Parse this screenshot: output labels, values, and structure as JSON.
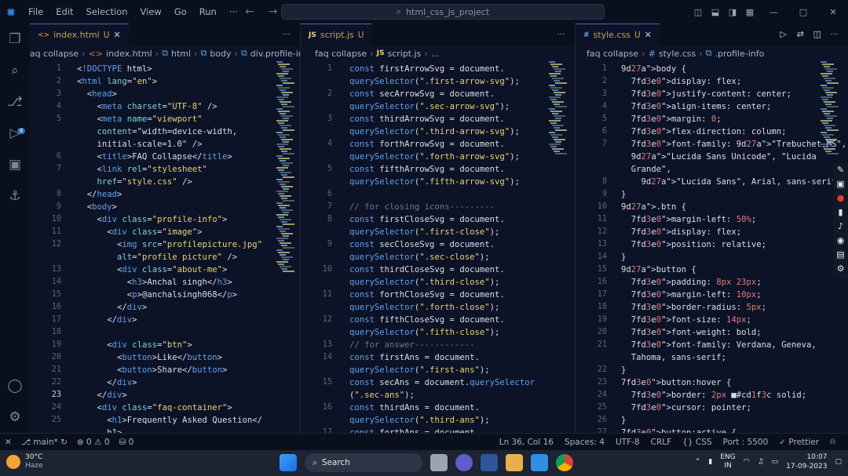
{
  "titlebar": {
    "menu": [
      "File",
      "Edit",
      "Selection",
      "View",
      "Go",
      "Run",
      "···"
    ],
    "search": "html_css_js_project"
  },
  "editors": [
    {
      "tab": {
        "name": "index.html",
        "status": "U"
      },
      "crumbs": [
        "faq collapse",
        "index.html",
        "html",
        "body",
        "div.profile-info"
      ],
      "lines": [
        {
          "n": "1",
          "t": "<!DOCTYPE html>"
        },
        {
          "n": "2",
          "t": "<html lang=\"en\">"
        },
        {
          "n": "3",
          "t": "  <head>"
        },
        {
          "n": "4",
          "t": "    <meta charset=\"UTF-8\" />"
        },
        {
          "n": "5",
          "t": "    <meta name=\"viewport\""
        },
        {
          "n": "",
          "t": "    content=\"width=device-width,"
        },
        {
          "n": "",
          "t": "    initial-scale=1.0\" />"
        },
        {
          "n": "6",
          "t": "    <title>FAQ Collapse</title>"
        },
        {
          "n": "7",
          "t": "    <link rel=\"stylesheet\""
        },
        {
          "n": "",
          "t": "    href=\"style.css\" />"
        },
        {
          "n": "8",
          "t": "  </head>"
        },
        {
          "n": "9",
          "t": "  <body>"
        },
        {
          "n": "10",
          "t": "    <div class=\"profile-info\">"
        },
        {
          "n": "11",
          "t": "      <div class=\"image\">"
        },
        {
          "n": "12",
          "t": "        <img src=\"profilepicture.jpg\""
        },
        {
          "n": "",
          "t": "        alt=\"profile picture\" />"
        },
        {
          "n": "13",
          "t": "        <div class=\"about-me\">"
        },
        {
          "n": "14",
          "t": "          <h3>Anchal singh</h3>"
        },
        {
          "n": "15",
          "t": "          <p>@anchalsingh068</p>"
        },
        {
          "n": "16",
          "t": "        </div>"
        },
        {
          "n": "17",
          "t": "      </div>"
        },
        {
          "n": "18",
          "t": ""
        },
        {
          "n": "19",
          "t": "      <div class=\"btn\">"
        },
        {
          "n": "20",
          "t": "        <button>Like</button>"
        },
        {
          "n": "21",
          "t": "        <button>Share</button>"
        },
        {
          "n": "22",
          "t": "      </div>"
        },
        {
          "n": "23",
          "t": "    </div>"
        },
        {
          "n": "24",
          "t": "    <div class=\"faq-container\">"
        },
        {
          "n": "25",
          "t": "      <h1>Frequently Asked Question</"
        },
        {
          "n": "",
          "t": "      h1>"
        }
      ]
    },
    {
      "tab": {
        "name": "script.js",
        "status": "U"
      },
      "crumbs": [
        "faq collapse",
        "script.js",
        "..."
      ],
      "lines": [
        {
          "n": "1",
          "t": "const firstArrowSvg = document."
        },
        {
          "n": "",
          "t": "querySelector(\".first-arrow-svg\");"
        },
        {
          "n": "2",
          "t": "const secArrowSvg = document."
        },
        {
          "n": "",
          "t": "querySelector(\".sec-arrow-svg\");"
        },
        {
          "n": "3",
          "t": "const thirdArrowSvg = document."
        },
        {
          "n": "",
          "t": "querySelector(\".third-arrow-svg\");"
        },
        {
          "n": "4",
          "t": "const forthArrowSvg = document."
        },
        {
          "n": "",
          "t": "querySelector(\".forth-arrow-svg\");"
        },
        {
          "n": "5",
          "t": "const fifthArrowSvg = document."
        },
        {
          "n": "",
          "t": "querySelector(\".fifth-arrow-svg\");"
        },
        {
          "n": "6",
          "t": ""
        },
        {
          "n": "7",
          "t": "// for closing icons---------"
        },
        {
          "n": "8",
          "t": "const firstCloseSvg = document."
        },
        {
          "n": "",
          "t": "querySelector(\".first-close\");"
        },
        {
          "n": "9",
          "t": "const secCloseSvg = document."
        },
        {
          "n": "",
          "t": "querySelector(\".sec-close\");"
        },
        {
          "n": "10",
          "t": "const thirdCloseSvg = document."
        },
        {
          "n": "",
          "t": "querySelector(\".third-close\");"
        },
        {
          "n": "11",
          "t": "const forthCloseSvg = document."
        },
        {
          "n": "",
          "t": "querySelector(\".forth-close\");"
        },
        {
          "n": "12",
          "t": "const fifthCloseSvg = document."
        },
        {
          "n": "",
          "t": "querySelector(\".fifth-close\");"
        },
        {
          "n": "13",
          "t": "// for answer------------"
        },
        {
          "n": "14",
          "t": "const firstAns = document."
        },
        {
          "n": "",
          "t": "querySelector(\".first-ans\");"
        },
        {
          "n": "15",
          "t": "const secAns = document.querySelector"
        },
        {
          "n": "",
          "t": "(\".sec-ans\");"
        },
        {
          "n": "16",
          "t": "const thirdAns = document."
        },
        {
          "n": "",
          "t": "querySelector(\".third-ans\");"
        },
        {
          "n": "17",
          "t": "const forthAns = document."
        }
      ]
    },
    {
      "tab": {
        "name": "style.css",
        "status": "U"
      },
      "crumbs": [
        "faq collapse",
        "style.css",
        ".profile-info"
      ],
      "lines": [
        {
          "n": "1",
          "t": "body {"
        },
        {
          "n": "2",
          "t": "  display: flex;"
        },
        {
          "n": "3",
          "t": "  justify-content: center;"
        },
        {
          "n": "4",
          "t": "  align-items: center;"
        },
        {
          "n": "5",
          "t": "  margin: 0;"
        },
        {
          "n": "6",
          "t": "  flex-direction: column;"
        },
        {
          "n": "7",
          "t": "  font-family: \"Trebuchet MS\","
        },
        {
          "n": "",
          "t": "  \"Lucida Sans Unicode\", \"Lucida"
        },
        {
          "n": "",
          "t": "  Grande\","
        },
        {
          "n": "8",
          "t": "    \"Lucida Sans\", Arial, sans-serif;"
        },
        {
          "n": "9",
          "t": "}"
        },
        {
          "n": "10",
          "t": ".btn {"
        },
        {
          "n": "11",
          "t": "  margin-left: 50%;"
        },
        {
          "n": "12",
          "t": "  display: flex;"
        },
        {
          "n": "13",
          "t": "  position: relative;"
        },
        {
          "n": "14",
          "t": "}"
        },
        {
          "n": "15",
          "t": "button {"
        },
        {
          "n": "16",
          "t": "  padding: 8px 23px;"
        },
        {
          "n": "17",
          "t": "  margin-left: 10px;"
        },
        {
          "n": "18",
          "t": "  border-radius: 5px;"
        },
        {
          "n": "19",
          "t": "  font-size: 14px;"
        },
        {
          "n": "20",
          "t": "  font-weight: bold;"
        },
        {
          "n": "21",
          "t": "  font-family: Verdana, Geneva,"
        },
        {
          "n": "",
          "t": "  Tahoma, sans-serif;"
        },
        {
          "n": "22",
          "t": "}"
        },
        {
          "n": "23",
          "t": "button:hover {"
        },
        {
          "n": "24",
          "t": "  border: 2px ■#cd1f3c solid;"
        },
        {
          "n": "25",
          "t": "  cursor: pointer;"
        },
        {
          "n": "26",
          "t": "}"
        },
        {
          "n": "27",
          "t": "button:active {"
        }
      ]
    }
  ],
  "statusbar": {
    "branch": "main*",
    "problems": "⊗ 0 ⚠ 0",
    "ports": "⛁ 0",
    "position": "Ln 36, Col 16",
    "spaces": "Spaces: 4",
    "encoding": "UTF-8",
    "eol": "CRLF",
    "language": "CSS",
    "port": "Port : 5500",
    "prettier": "✓ Prettier"
  },
  "taskbar": {
    "temp": "30°C",
    "weather": "Haze",
    "search": "Search",
    "lang": "ENG",
    "region": "IN",
    "time": "10:07",
    "date": "17-09-2023"
  },
  "colors": {
    "keyword": "#5ea1f0",
    "tag": "#5ea1f0",
    "string": "#e9d27a",
    "property": "#7fd3e0",
    "comment": "#6a7a8c",
    "accent": "#2f6fd1"
  }
}
